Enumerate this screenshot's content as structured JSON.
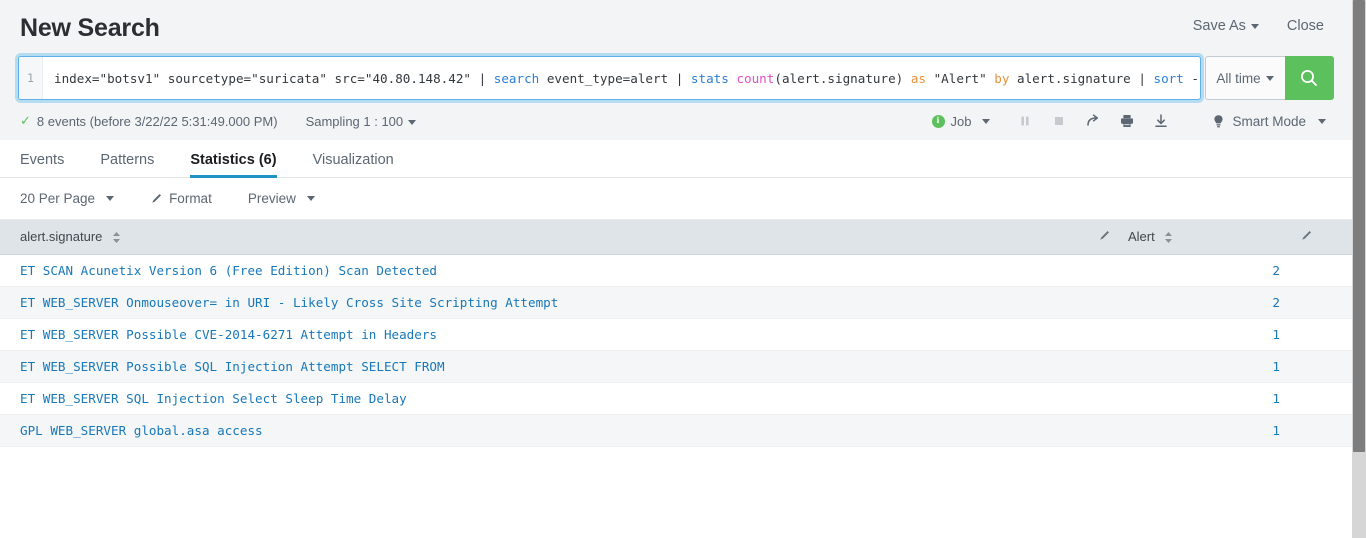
{
  "header": {
    "title": "New Search",
    "save_as_label": "Save As",
    "close_label": "Close"
  },
  "search": {
    "line_number": "1",
    "query_full": "index=\"botsv1\" sourcetype=\"suricata\" src=\"40.80.148.42\" | search event_type=alert | stats count(alert.signature) as \"Alert\" by alert.signature | sort - \"Alert\"",
    "tokens": {
      "t1": "index=\"botsv1\" sourcetype=\"suricata\" src=\"40.80.148.42\" | ",
      "t2": "search",
      "t3": " event_type=alert | ",
      "t4": "stats",
      "t5": " ",
      "t6": "count",
      "t7": "(alert.signature) ",
      "t8": "as",
      "t9": " \"Alert\" ",
      "t10": "by",
      "t11": " alert.signature | ",
      "t12": "sort",
      "t13": " - \"Alert\""
    },
    "time_range": "All time",
    "search_icon": "magnifier-icon",
    "search_button_color": "#5cc05c"
  },
  "infobar": {
    "check_glyph": "✓",
    "events_text": "8 events (before 3/22/22 5:31:49.000 PM)",
    "sampling_label": "Sampling 1 : 100",
    "job_label": "Job",
    "job_icon": "info-circle-icon",
    "controls": [
      {
        "name": "pause-icon",
        "glyph": "▐▌",
        "disabled": true
      },
      {
        "name": "stop-icon",
        "glyph": "■",
        "disabled": true
      },
      {
        "name": "share-icon",
        "glyph": "↗",
        "disabled": false
      },
      {
        "name": "print-icon",
        "glyph": "⎙",
        "disabled": false
      },
      {
        "name": "export-icon",
        "glyph": "⤓",
        "disabled": false
      }
    ],
    "mode_label": "Smart Mode",
    "mode_icon": "lightbulb-icon"
  },
  "tabs": [
    {
      "label": "Events",
      "active": false
    },
    {
      "label": "Patterns",
      "active": false
    },
    {
      "label": "Statistics (6)",
      "active": true
    },
    {
      "label": "Visualization",
      "active": false
    }
  ],
  "result_toolbar": {
    "per_page": "20 Per Page",
    "format": "Format",
    "format_icon": "pencil-icon",
    "preview": "Preview"
  },
  "table": {
    "columns": [
      {
        "label": "alert.signature",
        "sortable": true
      },
      {
        "label": "Alert",
        "sortable": true
      }
    ],
    "rows": [
      {
        "signature": "ET SCAN Acunetix Version 6 (Free Edition) Scan Detected",
        "alert": "2"
      },
      {
        "signature": "ET WEB_SERVER Onmouseover= in URI - Likely Cross Site Scripting Attempt",
        "alert": "2"
      },
      {
        "signature": "ET WEB_SERVER Possible CVE-2014-6271 Attempt in Headers",
        "alert": "1"
      },
      {
        "signature": "ET WEB_SERVER Possible SQL Injection Attempt SELECT FROM",
        "alert": "1"
      },
      {
        "signature": "ET WEB_SERVER SQL Injection Select Sleep Time Delay",
        "alert": "1"
      },
      {
        "signature": "GPL WEB_SERVER global.asa access",
        "alert": "1"
      }
    ]
  },
  "colors": {
    "accent_blue": "#1878b9",
    "tab_underline": "#1e93c6",
    "green": "#5cc05c",
    "header_bg": "#dfe4e8"
  }
}
